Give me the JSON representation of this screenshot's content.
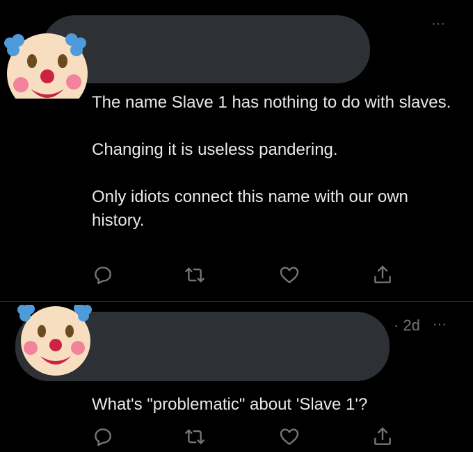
{
  "tweets": [
    {
      "avatar_icon": "clown-face-icon",
      "more_label": "···",
      "paragraphs": [
        "The name Slave 1 has nothing to do with slaves.",
        "Changing it is useless pandering.",
        "Only idiots connect this name with our own history."
      ],
      "actions": [
        "reply-icon",
        "retweet-icon",
        "like-icon",
        "share-icon"
      ]
    },
    {
      "avatar_icon": "clown-face-icon",
      "time": "· 2d",
      "more_label": "···",
      "text": "What's \"problematic\" about 'Slave 1'?",
      "actions": [
        "reply-icon",
        "retweet-icon",
        "like-icon",
        "share-icon"
      ]
    }
  ],
  "colors": {
    "background": "#000000",
    "text": "#e7e9ea",
    "muted": "#71767b",
    "redaction": "#2d3034",
    "divider": "#2f3336"
  }
}
